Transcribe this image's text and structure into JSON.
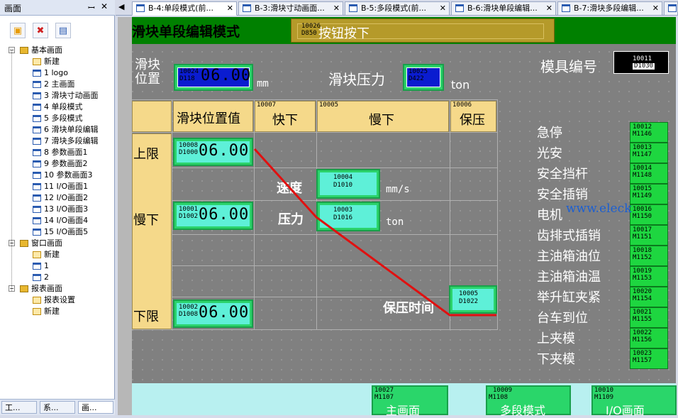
{
  "left_panel": {
    "title": "画面",
    "pin_glyph": "ꟷ",
    "close_glyph": "✕",
    "toolbar": [
      "new-page-icon",
      "delete-page-icon",
      "properties-icon"
    ],
    "tree": [
      {
        "label": "基本画面",
        "level": 0,
        "kind": "folder",
        "expand": "−"
      },
      {
        "label": "新建",
        "level": 1,
        "kind": "new"
      },
      {
        "label": "1 logo",
        "level": 1,
        "kind": "page"
      },
      {
        "label": "2 主画面",
        "level": 1,
        "kind": "page"
      },
      {
        "label": "3 滑块寸动画面",
        "level": 1,
        "kind": "page"
      },
      {
        "label": "4 单段模式",
        "level": 1,
        "kind": "page"
      },
      {
        "label": "5 多段模式",
        "level": 1,
        "kind": "page"
      },
      {
        "label": "6 滑块单段编辑",
        "level": 1,
        "kind": "page"
      },
      {
        "label": "7 滑块多段编辑",
        "level": 1,
        "kind": "page"
      },
      {
        "label": "8 参数画面1",
        "level": 1,
        "kind": "page"
      },
      {
        "label": "9 参数画面2",
        "level": 1,
        "kind": "page"
      },
      {
        "label": "10 参数画面3",
        "level": 1,
        "kind": "page"
      },
      {
        "label": "11 I/O画面1",
        "level": 1,
        "kind": "page"
      },
      {
        "label": "12 I/O画面2",
        "level": 1,
        "kind": "page"
      },
      {
        "label": "13 I/O画面3",
        "level": 1,
        "kind": "page"
      },
      {
        "label": "14 I/O画面4",
        "level": 1,
        "kind": "page"
      },
      {
        "label": "15 I/O画面5",
        "level": 1,
        "kind": "page"
      },
      {
        "label": "窗口画面",
        "level": 0,
        "kind": "folder",
        "expand": "−"
      },
      {
        "label": "新建",
        "level": 1,
        "kind": "new"
      },
      {
        "label": "1",
        "level": 1,
        "kind": "page"
      },
      {
        "label": "2",
        "level": 1,
        "kind": "page"
      },
      {
        "label": "报表画面",
        "level": 0,
        "kind": "folder",
        "expand": "−"
      },
      {
        "label": "报表设置",
        "level": 1,
        "kind": "new"
      },
      {
        "label": "新建",
        "level": 1,
        "kind": "new"
      }
    ],
    "bottom_tabs": [
      "工...",
      "系...",
      "画..."
    ]
  },
  "tabs": [
    {
      "label": "B-4:单段模式(前...",
      "active": true
    },
    {
      "label": "B-3:滑块寸动画面..."
    },
    {
      "label": "B-5:多段模式(前..."
    },
    {
      "label": "B-6:滑块单段编辑..."
    },
    {
      "label": "B-7:滑块多段编辑..."
    }
  ],
  "tab_close_glyph": "✕",
  "nav_glyph": "◀",
  "screen": {
    "title": "滑块单段编辑模式",
    "button_hint": {
      "tag": "10026",
      "sub": "D850",
      "text": "按钮按下"
    },
    "slider_pos_label": "滑块\n位置",
    "slider_pos": {
      "tag": "10024",
      "sub": "D118",
      "value": "06.00",
      "unit": "mm"
    },
    "slider_pressure_label": "滑块压力",
    "slider_pressure": {
      "tag": "10025",
      "sub": "D422",
      "unit": "ton"
    },
    "mold_label": "模具编号",
    "mold": {
      "tag": "10011",
      "sub": "D1030"
    },
    "table_headers": {
      "pos_value": "滑块位置值",
      "fast": {
        "tag": "10007",
        "label": "快下"
      },
      "slow": {
        "tag": "10005",
        "label": "慢下"
      },
      "hold": {
        "tag": "10006",
        "label": "保压"
      }
    },
    "rows": {
      "upper": {
        "label": "上限",
        "tag": "10008",
        "sub": "D1000",
        "value": "06.00"
      },
      "slow": {
        "label": "慢下",
        "tag": "10001",
        "sub": "D1002",
        "value": "06.00"
      },
      "lower": {
        "label": "下限",
        "tag": "10002",
        "sub": "D1008",
        "value": "06.00"
      }
    },
    "speed": {
      "label": "速度",
      "tag": "10004",
      "sub": "D1010",
      "unit": "mm/s"
    },
    "pressure": {
      "label": "压力",
      "tag": "10003",
      "sub": "D1016",
      "unit": "ton"
    },
    "hold_time": {
      "label": "保压时间",
      "tag": "10005",
      "sub": "D1022"
    },
    "status": [
      {
        "label": "急停",
        "tag": "10012",
        "sub": "M1146"
      },
      {
        "label": "光安",
        "tag": "10013",
        "sub": "M1147"
      },
      {
        "label": "安全挡杆",
        "tag": "10014",
        "sub": "M1148"
      },
      {
        "label": "安全插销",
        "tag": "10015",
        "sub": "M1149"
      },
      {
        "label": "电机",
        "tag": "10016",
        "sub": "M1150"
      },
      {
        "label": "齿排式插销",
        "tag": "10017",
        "sub": "M1151"
      },
      {
        "label": "主油箱油位",
        "tag": "10018",
        "sub": "M1152"
      },
      {
        "label": "主油箱油温",
        "tag": "10019",
        "sub": "M1153"
      },
      {
        "label": "举升缸夹紧",
        "tag": "10020",
        "sub": "M1154"
      },
      {
        "label": "台车到位",
        "tag": "10021",
        "sub": "M1155"
      },
      {
        "label": "上夹模",
        "tag": "10022",
        "sub": "M1156"
      },
      {
        "label": "下夹模",
        "tag": "10023",
        "sub": "M1157"
      }
    ],
    "watermark": "www.eleck",
    "nav": [
      {
        "tag": "10027",
        "sub": "M1107",
        "label": "主画面"
      },
      {
        "tag": "10009",
        "sub": "M1108",
        "label": "多段模式"
      },
      {
        "tag": "10010",
        "sub": "M1109",
        "label": "I/O画面"
      }
    ]
  }
}
